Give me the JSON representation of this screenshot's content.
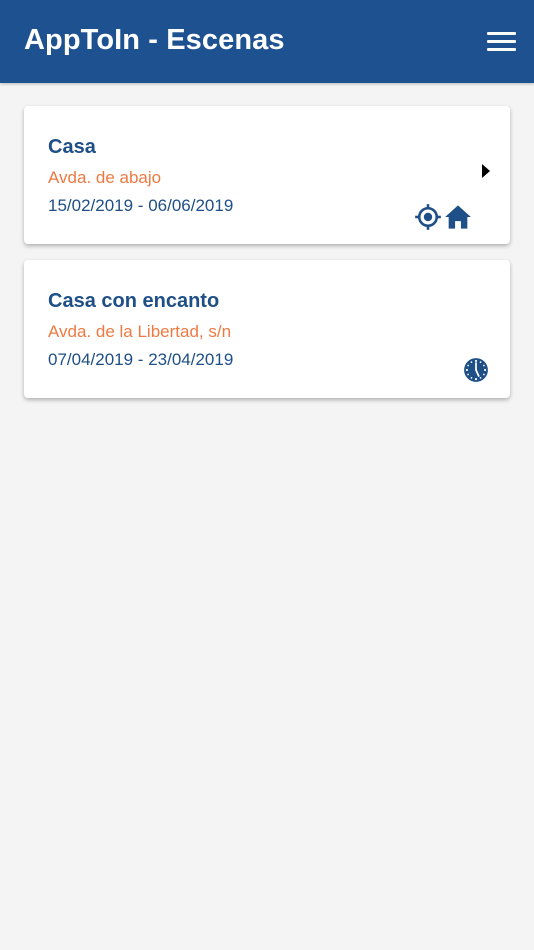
{
  "appbar": {
    "title": "AppToIn - Escenas",
    "menu_icon": "hamburger-menu-icon",
    "background_color": "#1e5190"
  },
  "colors": {
    "primary": "#1e4f86",
    "accent": "#ee7a42",
    "background": "#f4f4f4"
  },
  "scenes": [
    {
      "title": "Casa",
      "address": "Avda. de abajo",
      "dates": "15/02/2019 - 06/06/2019",
      "icons": [
        "location-target-icon",
        "home-icon"
      ],
      "selected_indicator": "chevron-right-icon"
    },
    {
      "title": "Casa con encanto",
      "address": "Avda. de la Libertad, s/n",
      "dates": "07/04/2019 - 23/04/2019",
      "icons": [
        "clock-icon"
      ]
    }
  ]
}
